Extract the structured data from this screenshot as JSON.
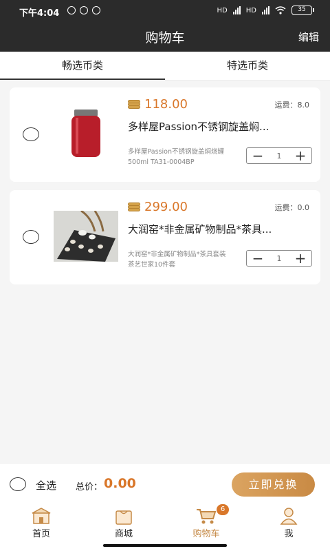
{
  "status": {
    "time": "下午4:04",
    "net1": "HD",
    "net2": "HD",
    "battery": "35"
  },
  "nav": {
    "title": "购物车",
    "edit": "编辑"
  },
  "tabs": [
    {
      "label": "畅选币类"
    },
    {
      "label": "特选币类"
    }
  ],
  "items": [
    {
      "price": "118.00",
      "ship": "运费：8.0",
      "name": "多样屋Passion不锈钢旋盖焖...",
      "desc": "多样屋Passion不锈钢旋盖焖烧罐500ml TA31-0004BP",
      "qty": "1"
    },
    {
      "price": "299.00",
      "ship": "运费：0.0",
      "name": "大润窑*非金属矿物制品*茶具...",
      "desc": "大润窑*非金属矿物制品*茶具套装茶艺世家10件套",
      "qty": "1"
    }
  ],
  "bottom": {
    "select_all": "全选",
    "total_label": "总价：",
    "total": "0.00",
    "redeem": "立即兑换"
  },
  "tabbar": [
    {
      "label": "首页"
    },
    {
      "label": "商城"
    },
    {
      "label": "购物车",
      "badge": "6"
    },
    {
      "label": "我"
    }
  ],
  "colors": {
    "accent": "#d9772a",
    "dark_bar": "#2b2b2b",
    "button": "#d39a53"
  }
}
